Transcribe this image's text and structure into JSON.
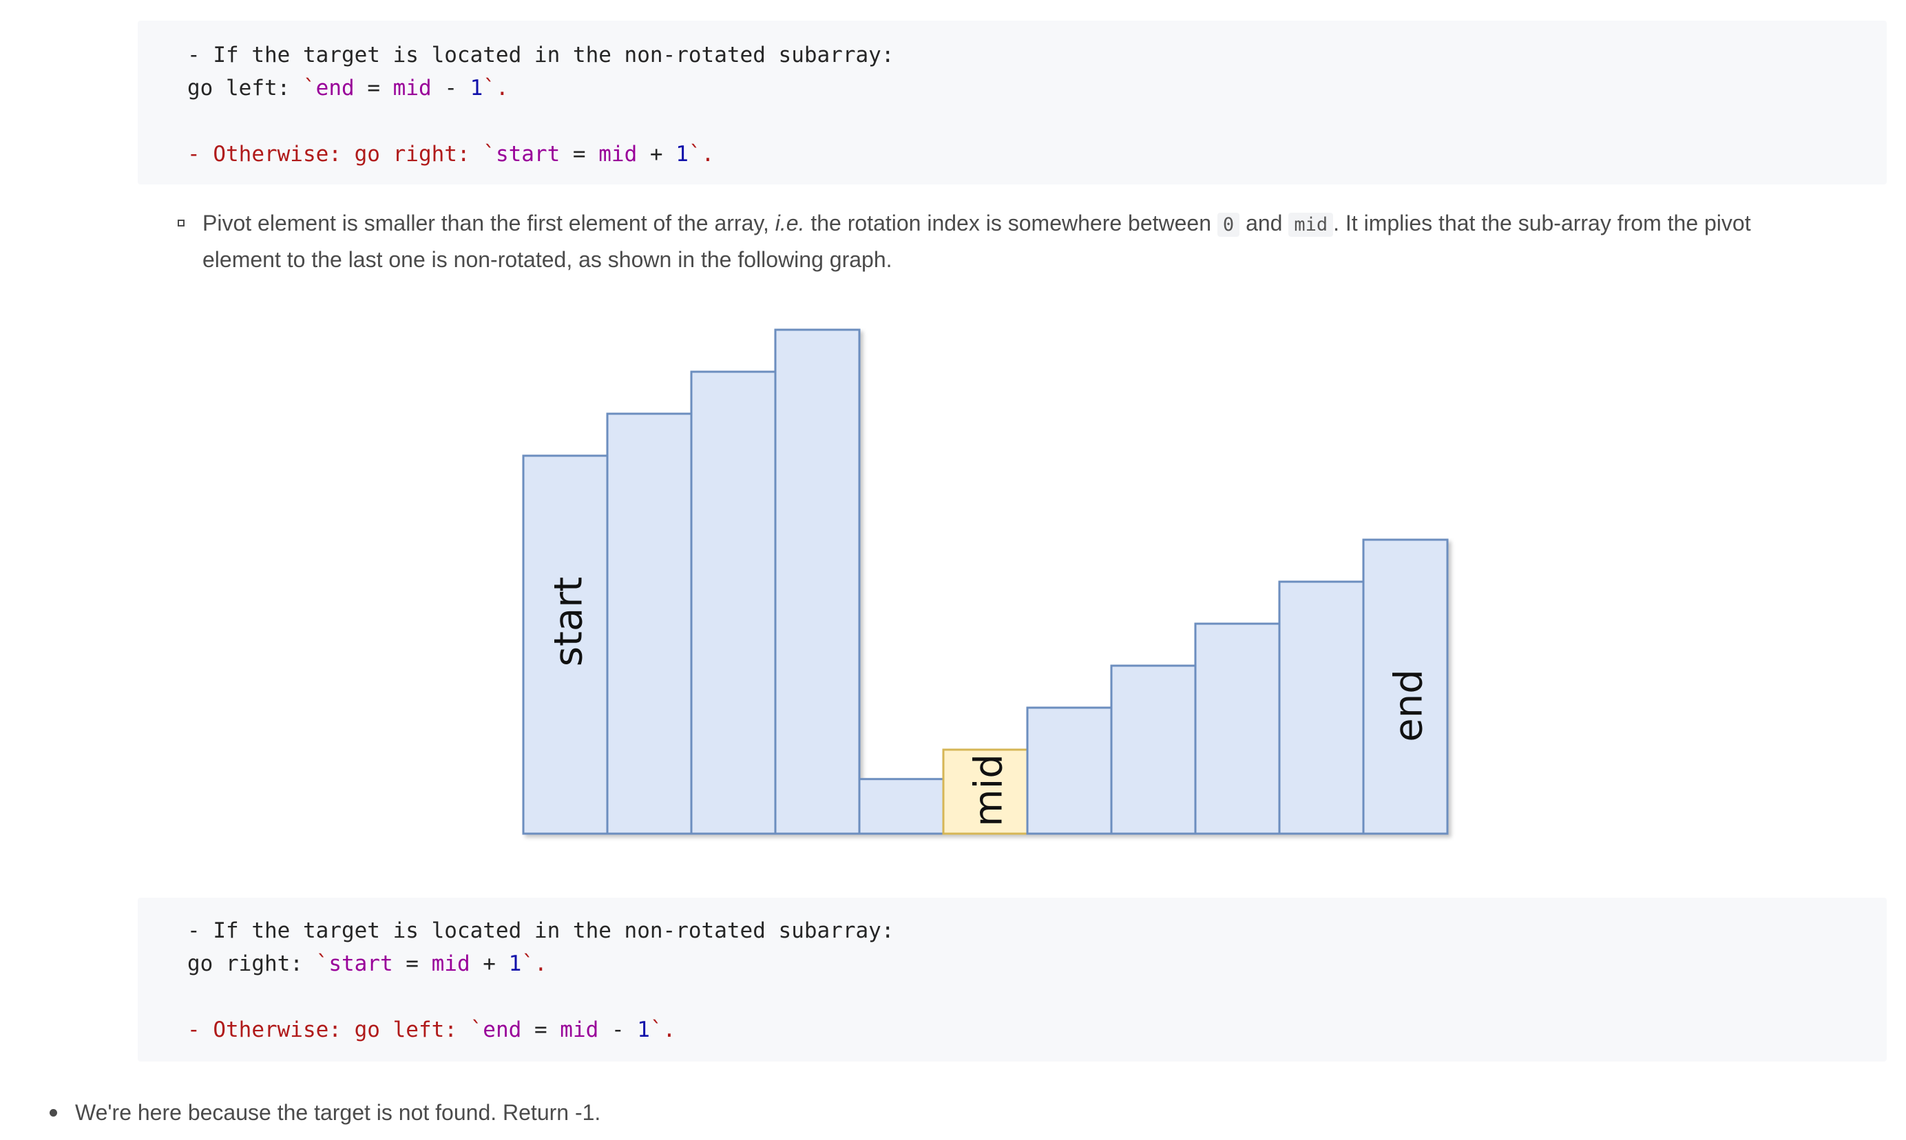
{
  "code_block_1": {
    "line1": "- If the target is located in the non-rotated subarray:",
    "line2_prefix": "go left: ",
    "line2_code": {
      "tick_open": "`",
      "var1": "end",
      "eq": " = ",
      "var2": "mid",
      "op": " - ",
      "num": "1",
      "tick_close": "`",
      "dot": "."
    },
    "line3_prefix": "- Otherwise: go right: ",
    "line3_code": {
      "tick_open": "`",
      "var1": "start",
      "eq": " = ",
      "var2": "mid",
      "op": " + ",
      "num": "1",
      "tick_close": "`",
      "dot": "."
    }
  },
  "bullet_pivot": {
    "text_a": "Pivot element is smaller than the first element of the array, ",
    "text_ie": "i.e.",
    "text_b": " the rotation index is somewhere between ",
    "code_zero": "0",
    "text_and": " and ",
    "code_mid": "mid",
    "text_c": ". It implies that the sub-array from the pivot",
    "text_line2": "element to the last one is non-rotated, as shown in the following graph."
  },
  "diagram": {
    "bar_values": [
      9,
      10,
      11,
      12,
      1.3,
      2,
      3,
      4,
      5,
      6,
      7
    ],
    "highlight_index": 5,
    "label_start": "start",
    "label_mid": "mid",
    "label_end": "end",
    "colors": {
      "bar_fill": "#dce6f7",
      "bar_stroke": "#6c8ebf",
      "mid_fill": "#fff2cc",
      "mid_stroke": "#d6b656"
    }
  },
  "code_block_2": {
    "line1": "- If the target is located in the non-rotated subarray:",
    "line2_prefix": "go right: ",
    "line2_code": {
      "tick_open": "`",
      "var1": "start",
      "eq": " = ",
      "var2": "mid",
      "op": " + ",
      "num": "1",
      "tick_close": "`",
      "dot": "."
    },
    "line3_prefix": "- Otherwise: go left: ",
    "line3_code": {
      "tick_open": "`",
      "var1": "end",
      "eq": " = ",
      "var2": "mid",
      "op": " - ",
      "num": "1",
      "tick_close": "`",
      "dot": "."
    }
  },
  "bullet_notfound": {
    "text": "We're here because the target is not found. Return -1."
  }
}
